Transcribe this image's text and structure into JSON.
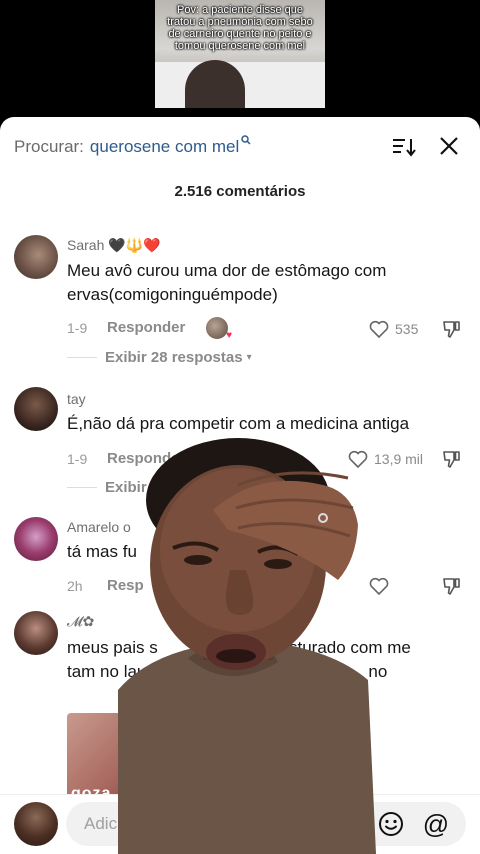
{
  "video": {
    "caption": "Pov: a paciente disse que tratou a pneumonia com sebo de carneiro quente no peito e tomou querosene com mel"
  },
  "search": {
    "prefix": "Procurar:",
    "query": "querosene com mel",
    "mag_icon": "search-icon"
  },
  "header": {
    "comment_count": "2.516 comentários"
  },
  "comments": [
    {
      "username": "Sarah 🖤🔱❤️",
      "text": "Meu avô curou uma dor de estômago com ervas(comigoninguémpode)",
      "date": "1-9",
      "reply_label": "Responder",
      "likes": "535",
      "view_replies": "Exibir 28 respostas"
    },
    {
      "username": "tay",
      "text": "É,não dá pra competir com a medicina antiga",
      "date": "1-9",
      "reply_label": "Responder",
      "likes": "13,9 mil",
      "view_replies": "Exibir"
    },
    {
      "username": "Amarelo o",
      "text": "tá mas fu",
      "date": "2h",
      "reply_label": "Resp"
    },
    {
      "username": "𝓜✿",
      "text": "meus pais s                        misturado com me                          tam no laudo                                           no",
      "image_text": "goza"
    }
  ],
  "input": {
    "placeholder": "Adicionar comentário..."
  },
  "colors": {
    "query": "#2f5b8d",
    "like_red": "#fe2c55",
    "sheet_bg": "#ffffff"
  }
}
